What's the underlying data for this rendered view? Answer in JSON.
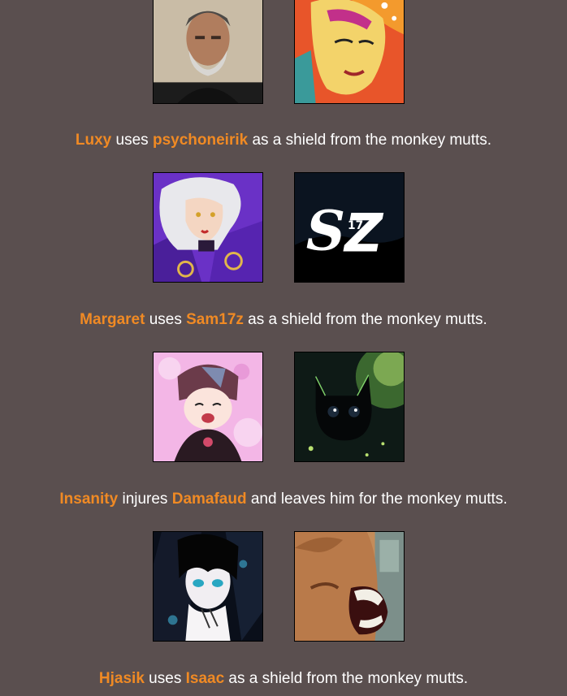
{
  "events": [
    {
      "actor": "Luxy",
      "verb": " uses ",
      "target": "psychoneirik",
      "rest": " as a shield from the monkey mutts.",
      "actor_avatar": "bearded-man-avatar",
      "target_avatar": "anime-woman-orange-hat-avatar"
    },
    {
      "actor": "Margaret",
      "verb": " uses ",
      "target": "Sam17z",
      "rest": " as a shield from the monkey mutts.",
      "actor_avatar": "white-haired-anime-woman-avatar",
      "target_avatar": "sz-logo-avatar"
    },
    {
      "actor": "Insanity",
      "verb": " injures ",
      "target": "Damafaud",
      "rest": " and leaves him for the monkey mutts.",
      "actor_avatar": "anime-girl-pink-avatar",
      "target_avatar": "black-cat-avatar"
    },
    {
      "actor": "Hjasik",
      "verb": " uses ",
      "target": "Isaac",
      "rest": " as a shield from the monkey mutts.",
      "actor_avatar": "dark-haired-anime-avatar",
      "target_avatar": "yelling-face-avatar"
    }
  ],
  "colors": {
    "background": "#5a4f4f",
    "name": "#f08a24",
    "text": "#ffffff"
  }
}
